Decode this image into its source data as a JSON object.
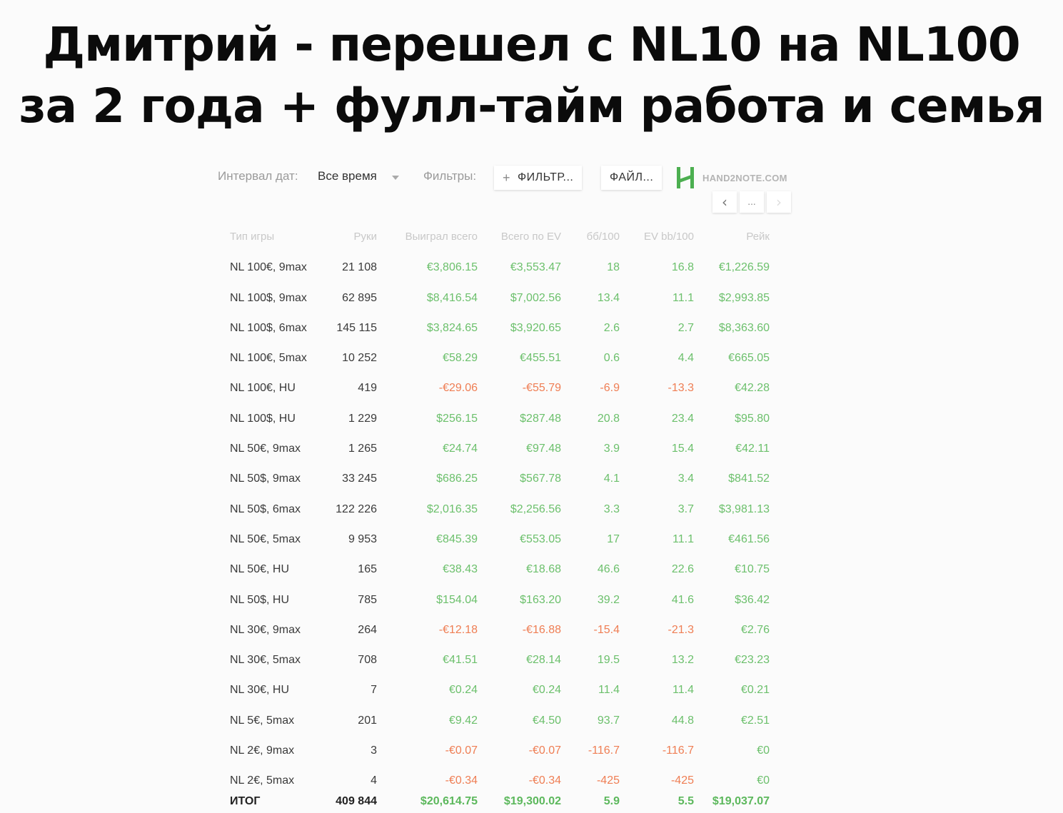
{
  "headline": {
    "line1": "Дмитрий - перешел с NL10 на NL100",
    "line2": "за 2 года + фулл-тайм работа и семья"
  },
  "toolbar": {
    "date_label": "Интервал дат:",
    "date_value": "Все время",
    "filters_label": "Фильтры:",
    "filter_button": "ФИЛЬТР...",
    "files_button": "ФАЙЛ...",
    "logo_text": "HAND2NOTE.COM"
  },
  "pager": {
    "prev": "‹",
    "dots": "...",
    "next": "›"
  },
  "colors": {
    "positive": "#6cc06c",
    "negative": "#ef7e54",
    "logo": "#4caf50"
  },
  "table": {
    "headers": [
      "Тип игры",
      "Руки",
      "Выиграл всего",
      "Всего по EV",
      "бб/100",
      "EV bb/100",
      "Рейк"
    ],
    "rows": [
      [
        "NL 100€, 9max",
        "21 108",
        "€3,806.15",
        "€3,553.47",
        "18",
        "16.8",
        "€1,226.59"
      ],
      [
        "NL 100$, 9max",
        "62 895",
        "$8,416.54",
        "$7,002.56",
        "13.4",
        "11.1",
        "$2,993.85"
      ],
      [
        "NL 100$, 6max",
        "145 115",
        "$3,824.65",
        "$3,920.65",
        "2.6",
        "2.7",
        "$8,363.60"
      ],
      [
        "NL 100€, 5max",
        "10 252",
        "€58.29",
        "€455.51",
        "0.6",
        "4.4",
        "€665.05"
      ],
      [
        "NL 100€, HU",
        "419",
        "-€29.06",
        "-€55.79",
        "-6.9",
        "-13.3",
        "€42.28"
      ],
      [
        "NL 100$, HU",
        "1 229",
        "$256.15",
        "$287.48",
        "20.8",
        "23.4",
        "$95.80"
      ],
      [
        "NL 50€, 9max",
        "1 265",
        "€24.74",
        "€97.48",
        "3.9",
        "15.4",
        "€42.11"
      ],
      [
        "NL 50$, 9max",
        "33 245",
        "$686.25",
        "$567.78",
        "4.1",
        "3.4",
        "$841.52"
      ],
      [
        "NL 50$, 6max",
        "122 226",
        "$2,016.35",
        "$2,256.56",
        "3.3",
        "3.7",
        "$3,981.13"
      ],
      [
        "NL 50€, 5max",
        "9 953",
        "€845.39",
        "€553.05",
        "17",
        "11.1",
        "€461.56"
      ],
      [
        "NL 50€, HU",
        "165",
        "€38.43",
        "€18.68",
        "46.6",
        "22.6",
        "€10.75"
      ],
      [
        "NL 50$, HU",
        "785",
        "$154.04",
        "$163.20",
        "39.2",
        "41.6",
        "$36.42"
      ],
      [
        "NL 30€, 9max",
        "264",
        "-€12.18",
        "-€16.88",
        "-15.4",
        "-21.3",
        "€2.76"
      ],
      [
        "NL 30€, 5max",
        "708",
        "€41.51",
        "€28.14",
        "19.5",
        "13.2",
        "€23.23"
      ],
      [
        "NL 30€, HU",
        "7",
        "€0.24",
        "€0.24",
        "11.4",
        "11.4",
        "€0.21"
      ],
      [
        "NL 5€, 5max",
        "201",
        "€9.42",
        "€4.50",
        "93.7",
        "44.8",
        "€2.51"
      ],
      [
        "NL 2€, 9max",
        "3",
        "-€0.07",
        "-€0.07",
        "-116.7",
        "-116.7",
        "€0"
      ],
      [
        "NL 2€, 5max",
        "4",
        "-€0.34",
        "-€0.34",
        "-425",
        "-425",
        "€0"
      ]
    ],
    "total": [
      "ИТОГ",
      "409 844",
      "$20,614.75",
      "$19,300.02",
      "5.9",
      "5.5",
      "$19,037.07"
    ]
  }
}
